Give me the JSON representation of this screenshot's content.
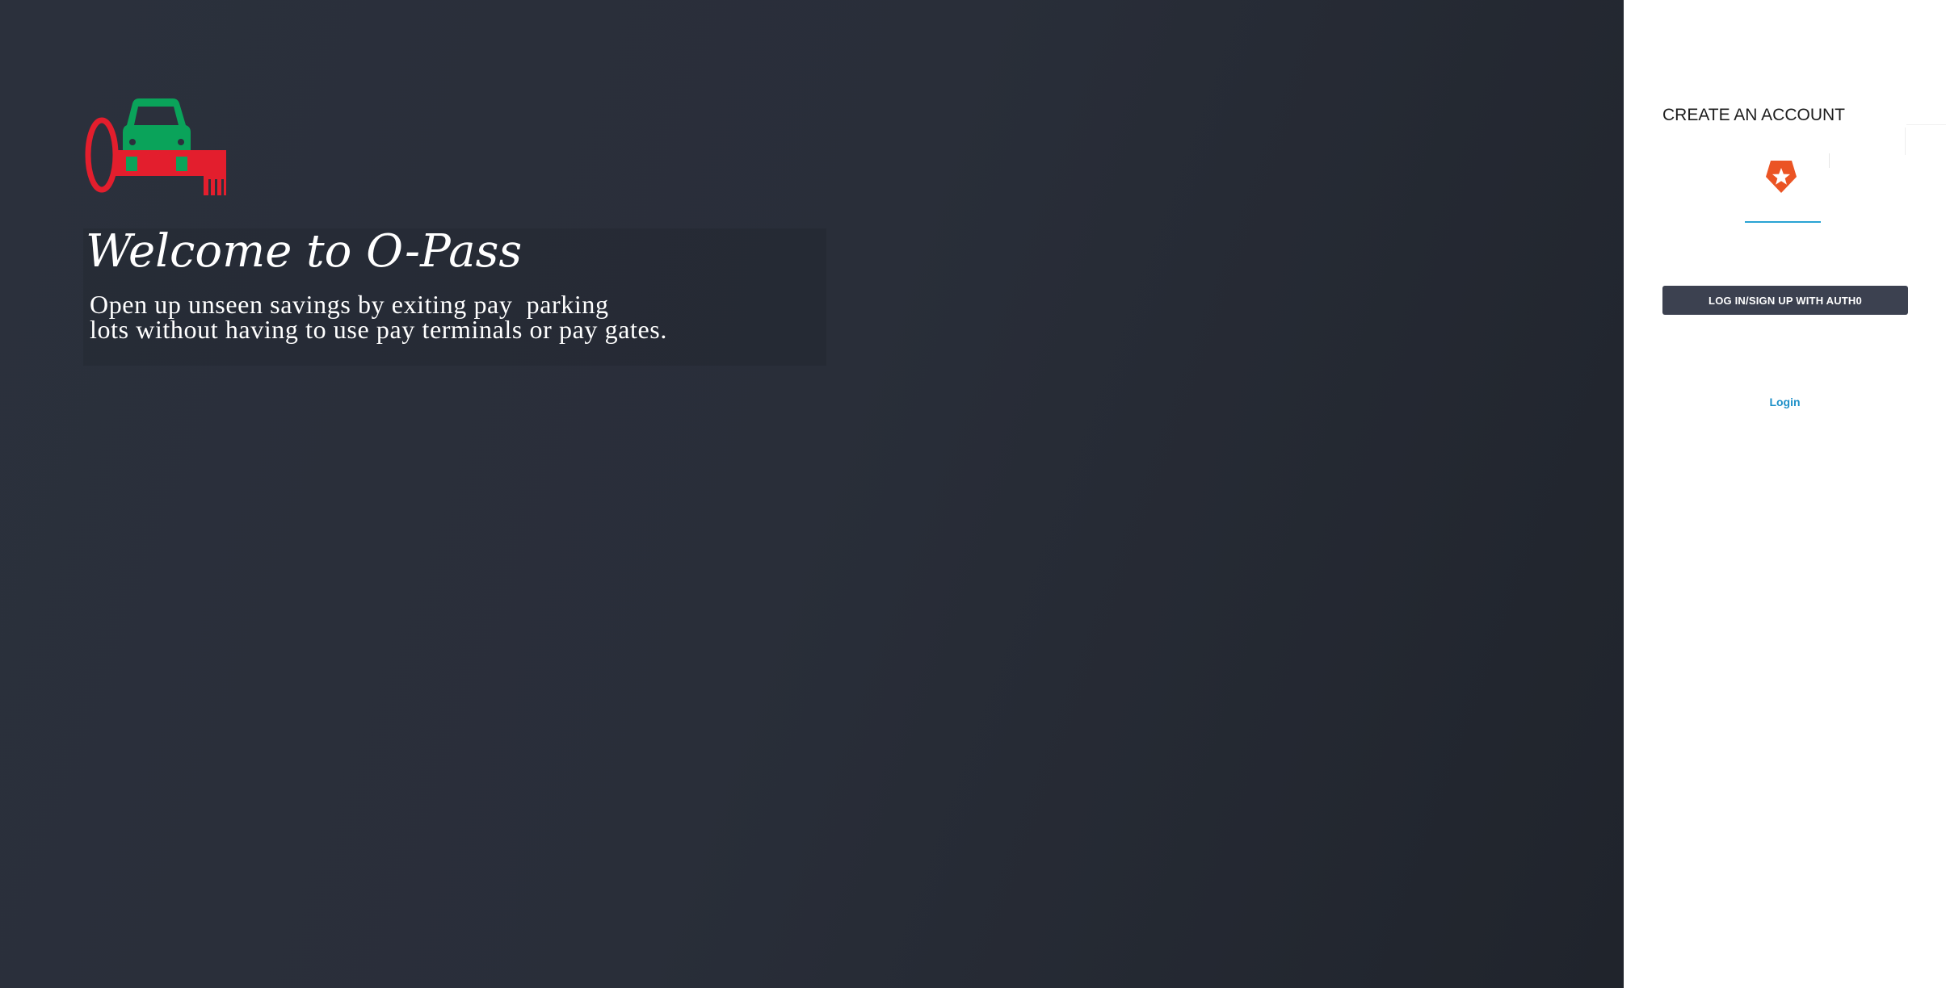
{
  "hero": {
    "title": "Welcome to O-Pass",
    "tagline_lines": [
      "Open up unseen savings by exiting pay  parking",
      "lots without having to use pay terminals or pay gates."
    ],
    "logo_icon": "car-key-logo-icon"
  },
  "signup": {
    "title": "CREATE AN ACCOUNT",
    "provider_icon": "auth0-icon",
    "auth_button_label": "LOG IN/SIGN UP WITH AUTH0",
    "login_link_label": "Login"
  },
  "colors": {
    "left_panel_bg": "#2b303c",
    "logo_red": "#e31e2d",
    "logo_green": "#0aa35a",
    "auth0_orange": "#eb5424",
    "button_bg": "#3c4150",
    "link_blue": "#1e90c8",
    "tab_underline": "#2aa3d3"
  }
}
